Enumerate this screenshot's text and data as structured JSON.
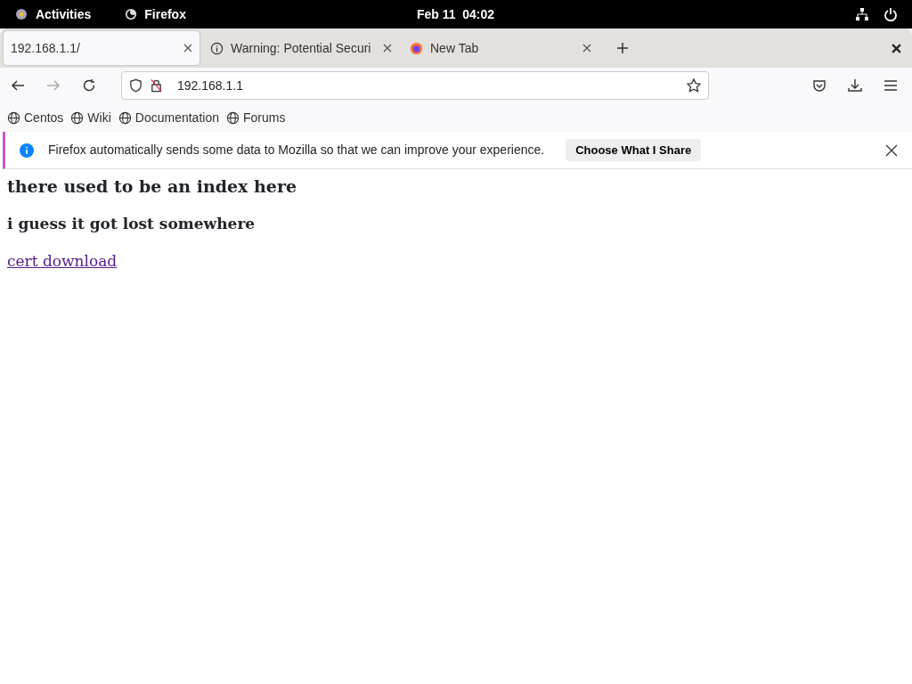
{
  "top_bar": {
    "activities": "Activities",
    "app": "Firefox",
    "clock": "Feb 11  04:02"
  },
  "tabs": [
    {
      "label": "192.168.1.1/",
      "selected": true,
      "kind": "plain"
    },
    {
      "label": "Warning: Potential Securi",
      "selected": false,
      "kind": "info"
    },
    {
      "label": "New Tab",
      "selected": false,
      "kind": "firefox"
    }
  ],
  "address_bar": {
    "url": "192.168.1.1"
  },
  "bookmarks": [
    "Centos",
    "Wiki",
    "Documentation",
    "Forums"
  ],
  "notification": {
    "text": "Firefox automatically sends some data to Mozilla so that we can improve your experience.",
    "button": "Choose What I Share"
  },
  "page": {
    "heading": "there used to be an index here",
    "subheading": "i guess it got lost somewhere",
    "link": "cert download"
  }
}
